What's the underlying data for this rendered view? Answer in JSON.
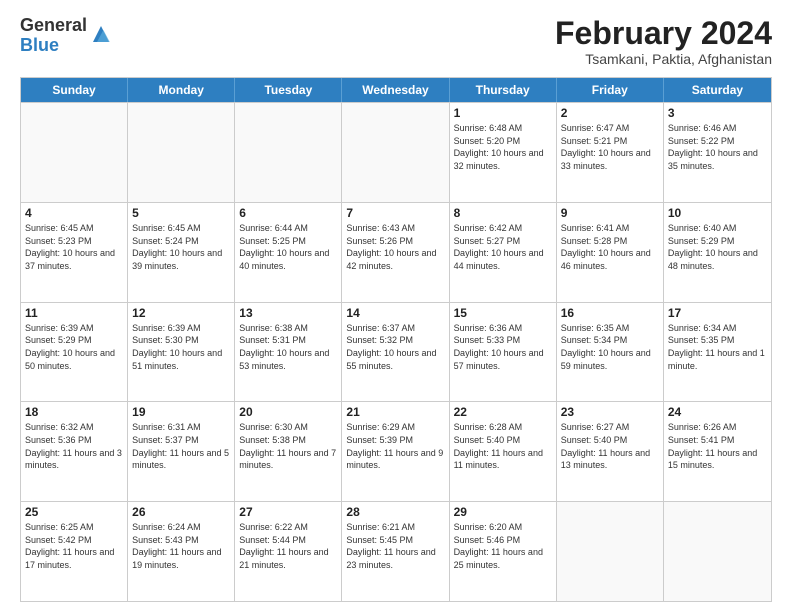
{
  "logo": {
    "general": "General",
    "blue": "Blue"
  },
  "title": "February 2024",
  "location": "Tsamkani, Paktia, Afghanistan",
  "days_of_week": [
    "Sunday",
    "Monday",
    "Tuesday",
    "Wednesday",
    "Thursday",
    "Friday",
    "Saturday"
  ],
  "weeks": [
    [
      {
        "day": "",
        "text": ""
      },
      {
        "day": "",
        "text": ""
      },
      {
        "day": "",
        "text": ""
      },
      {
        "day": "",
        "text": ""
      },
      {
        "day": "1",
        "text": "Sunrise: 6:48 AM\nSunset: 5:20 PM\nDaylight: 10 hours and 32 minutes."
      },
      {
        "day": "2",
        "text": "Sunrise: 6:47 AM\nSunset: 5:21 PM\nDaylight: 10 hours and 33 minutes."
      },
      {
        "day": "3",
        "text": "Sunrise: 6:46 AM\nSunset: 5:22 PM\nDaylight: 10 hours and 35 minutes."
      }
    ],
    [
      {
        "day": "4",
        "text": "Sunrise: 6:45 AM\nSunset: 5:23 PM\nDaylight: 10 hours and 37 minutes."
      },
      {
        "day": "5",
        "text": "Sunrise: 6:45 AM\nSunset: 5:24 PM\nDaylight: 10 hours and 39 minutes."
      },
      {
        "day": "6",
        "text": "Sunrise: 6:44 AM\nSunset: 5:25 PM\nDaylight: 10 hours and 40 minutes."
      },
      {
        "day": "7",
        "text": "Sunrise: 6:43 AM\nSunset: 5:26 PM\nDaylight: 10 hours and 42 minutes."
      },
      {
        "day": "8",
        "text": "Sunrise: 6:42 AM\nSunset: 5:27 PM\nDaylight: 10 hours and 44 minutes."
      },
      {
        "day": "9",
        "text": "Sunrise: 6:41 AM\nSunset: 5:28 PM\nDaylight: 10 hours and 46 minutes."
      },
      {
        "day": "10",
        "text": "Sunrise: 6:40 AM\nSunset: 5:29 PM\nDaylight: 10 hours and 48 minutes."
      }
    ],
    [
      {
        "day": "11",
        "text": "Sunrise: 6:39 AM\nSunset: 5:29 PM\nDaylight: 10 hours and 50 minutes."
      },
      {
        "day": "12",
        "text": "Sunrise: 6:39 AM\nSunset: 5:30 PM\nDaylight: 10 hours and 51 minutes."
      },
      {
        "day": "13",
        "text": "Sunrise: 6:38 AM\nSunset: 5:31 PM\nDaylight: 10 hours and 53 minutes."
      },
      {
        "day": "14",
        "text": "Sunrise: 6:37 AM\nSunset: 5:32 PM\nDaylight: 10 hours and 55 minutes."
      },
      {
        "day": "15",
        "text": "Sunrise: 6:36 AM\nSunset: 5:33 PM\nDaylight: 10 hours and 57 minutes."
      },
      {
        "day": "16",
        "text": "Sunrise: 6:35 AM\nSunset: 5:34 PM\nDaylight: 10 hours and 59 minutes."
      },
      {
        "day": "17",
        "text": "Sunrise: 6:34 AM\nSunset: 5:35 PM\nDaylight: 11 hours and 1 minute."
      }
    ],
    [
      {
        "day": "18",
        "text": "Sunrise: 6:32 AM\nSunset: 5:36 PM\nDaylight: 11 hours and 3 minutes."
      },
      {
        "day": "19",
        "text": "Sunrise: 6:31 AM\nSunset: 5:37 PM\nDaylight: 11 hours and 5 minutes."
      },
      {
        "day": "20",
        "text": "Sunrise: 6:30 AM\nSunset: 5:38 PM\nDaylight: 11 hours and 7 minutes."
      },
      {
        "day": "21",
        "text": "Sunrise: 6:29 AM\nSunset: 5:39 PM\nDaylight: 11 hours and 9 minutes."
      },
      {
        "day": "22",
        "text": "Sunrise: 6:28 AM\nSunset: 5:40 PM\nDaylight: 11 hours and 11 minutes."
      },
      {
        "day": "23",
        "text": "Sunrise: 6:27 AM\nSunset: 5:40 PM\nDaylight: 11 hours and 13 minutes."
      },
      {
        "day": "24",
        "text": "Sunrise: 6:26 AM\nSunset: 5:41 PM\nDaylight: 11 hours and 15 minutes."
      }
    ],
    [
      {
        "day": "25",
        "text": "Sunrise: 6:25 AM\nSunset: 5:42 PM\nDaylight: 11 hours and 17 minutes."
      },
      {
        "day": "26",
        "text": "Sunrise: 6:24 AM\nSunset: 5:43 PM\nDaylight: 11 hours and 19 minutes."
      },
      {
        "day": "27",
        "text": "Sunrise: 6:22 AM\nSunset: 5:44 PM\nDaylight: 11 hours and 21 minutes."
      },
      {
        "day": "28",
        "text": "Sunrise: 6:21 AM\nSunset: 5:45 PM\nDaylight: 11 hours and 23 minutes."
      },
      {
        "day": "29",
        "text": "Sunrise: 6:20 AM\nSunset: 5:46 PM\nDaylight: 11 hours and 25 minutes."
      },
      {
        "day": "",
        "text": ""
      },
      {
        "day": "",
        "text": ""
      }
    ]
  ]
}
